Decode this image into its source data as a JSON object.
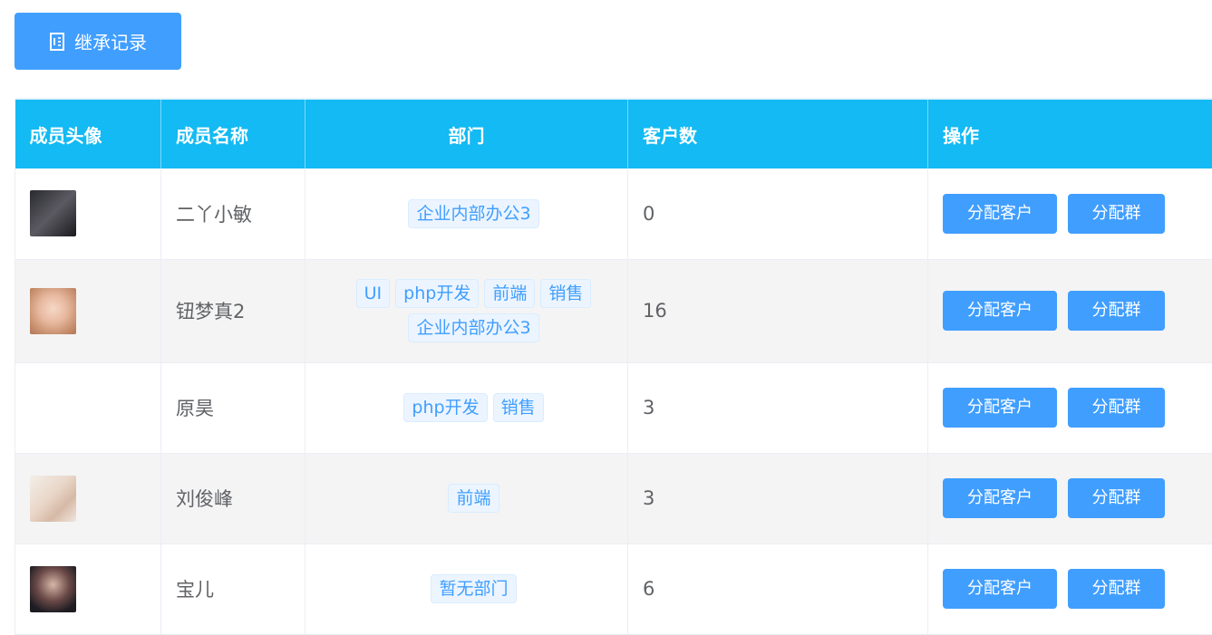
{
  "toolbar": {
    "inherit_label": "继承记录"
  },
  "table": {
    "headers": {
      "avatar": "成员头像",
      "name": "成员名称",
      "dept": "部门",
      "customers": "客户数",
      "ops": "操作"
    },
    "rows": [
      {
        "name": "二丫小敏",
        "depts": [
          "企业内部办公3"
        ],
        "customers": "0",
        "has_avatar": true
      },
      {
        "name": "钮梦真2",
        "depts": [
          "UI",
          "php开发",
          "前端",
          "销售",
          "企业内部办公3"
        ],
        "customers": "16",
        "has_avatar": true
      },
      {
        "name": "原昊",
        "depts": [
          "php开发",
          "销售"
        ],
        "customers": "3",
        "has_avatar": false
      },
      {
        "name": "刘俊峰",
        "depts": [
          "前端"
        ],
        "customers": "3",
        "has_avatar": true
      },
      {
        "name": "宝儿",
        "depts": [
          "暂无部门"
        ],
        "customers": "6",
        "has_avatar": true
      }
    ],
    "op_assign_customer": "分配客户",
    "op_assign_group": "分配群"
  },
  "colors": {
    "header_bg": "#13baf3",
    "primary": "#409eff",
    "tag_bg": "#ecf5ff"
  }
}
